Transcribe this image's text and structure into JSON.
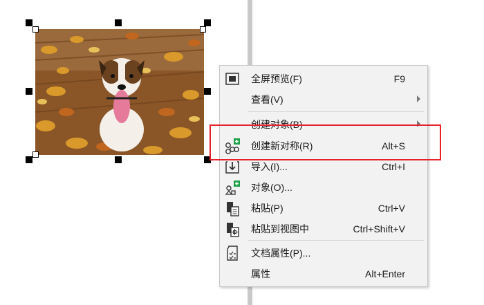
{
  "menu": {
    "items": [
      {
        "label": "全屏预览(F)",
        "shortcut": "F9",
        "icon": "fullscreen-preview-icon",
        "submenu": false
      },
      {
        "label": "查看(V)",
        "shortcut": "",
        "icon": "",
        "submenu": true
      },
      {
        "label": "创建对象(B)",
        "shortcut": "",
        "icon": "",
        "submenu": true
      },
      {
        "label": "创建新对称(R)",
        "shortcut": "Alt+S",
        "icon": "symmetry-icon",
        "submenu": false
      },
      {
        "label": "导入(I)...",
        "shortcut": "Ctrl+I",
        "icon": "import-icon",
        "submenu": false
      },
      {
        "label": "对象(O)...",
        "shortcut": "",
        "icon": "objects-icon",
        "submenu": false
      },
      {
        "label": "粘贴(P)",
        "shortcut": "Ctrl+V",
        "icon": "paste-icon",
        "submenu": false
      },
      {
        "label": "粘贴到视图中",
        "shortcut": "Ctrl+Shift+V",
        "icon": "paste-in-view-icon",
        "submenu": false
      },
      {
        "label": "文档属性(P)...",
        "shortcut": "",
        "icon": "document-properties-icon",
        "submenu": false
      },
      {
        "label": "属性",
        "shortcut": "Alt+Enter",
        "icon": "",
        "submenu": false
      }
    ]
  },
  "colors": {
    "highlight": "#e8202a",
    "menu_bg": "#f2f2f2",
    "accent_green": "#1ea34a"
  }
}
